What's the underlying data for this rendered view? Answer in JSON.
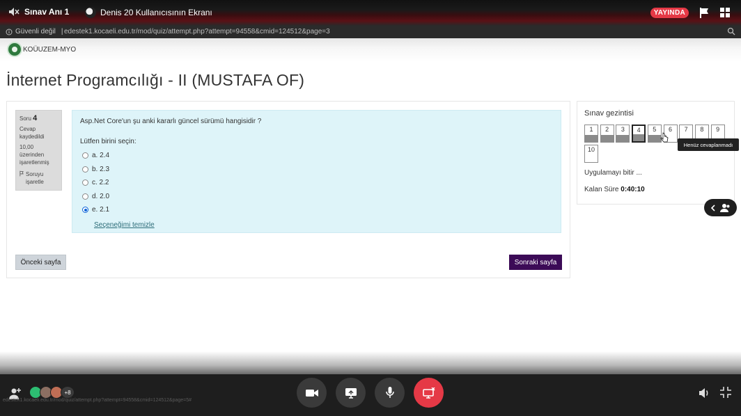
{
  "meeting": {
    "room_name": "Sınav Anı 1",
    "presenter_label": "Denis 20 Kullanıcısının Ekranı",
    "live_badge": "YAYINDA",
    "participants_more": "+8",
    "colors": {
      "live": "#e53946",
      "end_call": "#e53946",
      "bar": "#1e1e1e"
    }
  },
  "browser": {
    "security_label": "Güvenli değil",
    "url": "edestek1.kocaeli.edu.tr/mod/quiz/attempt.php?attempt=94558&cmid=124512&page=3",
    "status_url": "edestek1.kocaeli.edu.tr/mod/quiz/attempt.php?attempt=94558&cmid=124512&page=5#"
  },
  "site": {
    "brand": "KOÜUZEM-MYO",
    "course_title": "İnternet Programcılığı - II (MUSTAFA OF)"
  },
  "question": {
    "label": "Soru",
    "number": "4",
    "status": "Cevap kaydedildi",
    "marks": "10,00 üzerinden işaretlenmiş",
    "flag_label": "Soruyu işaretle",
    "text": "Asp.Net Core'un şu anki kararlı güncel sürümü hangisidir ?",
    "prompt": "Lütfen birini seçin:",
    "options": [
      {
        "label": "a. 2.4",
        "selected": false
      },
      {
        "label": "b. 2.3",
        "selected": false
      },
      {
        "label": "c. 2.2",
        "selected": false
      },
      {
        "label": "d. 2.0",
        "selected": false
      },
      {
        "label": "e. 2.1",
        "selected": true
      }
    ],
    "clear_label": "Seçeneğimi temizle"
  },
  "buttons": {
    "previous": "Önceki sayfa",
    "next": "Sonraki sayfa",
    "next_color": "#3c0b57"
  },
  "quiz_nav": {
    "title": "Sınav gezintisi",
    "questions": [
      {
        "label": "1",
        "answered": true,
        "current": false
      },
      {
        "label": "2",
        "answered": true,
        "current": false
      },
      {
        "label": "3",
        "answered": true,
        "current": false
      },
      {
        "label": "4",
        "answered": true,
        "current": true
      },
      {
        "label": "5",
        "answered": true,
        "current": false
      },
      {
        "label": "6",
        "answered": false,
        "current": false
      },
      {
        "label": "7",
        "answered": false,
        "current": false
      },
      {
        "label": "8",
        "answered": false,
        "current": false
      },
      {
        "label": "9",
        "answered": false,
        "current": false
      },
      {
        "label": "10",
        "answered": false,
        "current": false
      }
    ],
    "tooltip": "Henüz cevaplanmadı",
    "finish_label": "Uygulamayı bitir ...",
    "time_label": "Kalan Süre",
    "time_value": "0:40:10"
  }
}
